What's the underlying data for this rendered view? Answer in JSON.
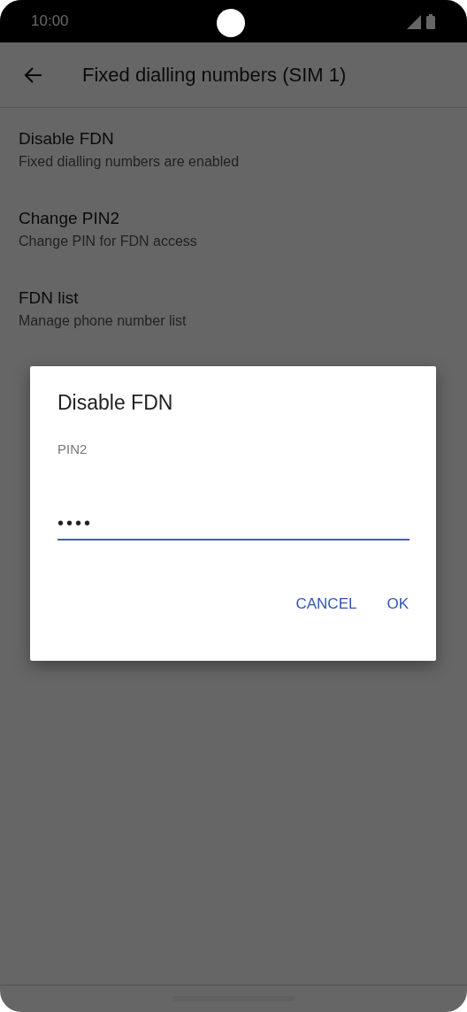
{
  "status_bar": {
    "time": "10:00"
  },
  "app_bar": {
    "title": "Fixed dialling numbers (SIM 1)"
  },
  "settings": [
    {
      "title": "Disable FDN",
      "summary": "Fixed dialling numbers are enabled"
    },
    {
      "title": "Change PIN2",
      "summary": "Change PIN for FDN access"
    },
    {
      "title": "FDN list",
      "summary": "Manage phone number list"
    }
  ],
  "dialog": {
    "title": "Disable FDN",
    "field": {
      "label": "PIN2",
      "value": "••••"
    },
    "buttons": [
      "CANCEL",
      "OK"
    ]
  }
}
